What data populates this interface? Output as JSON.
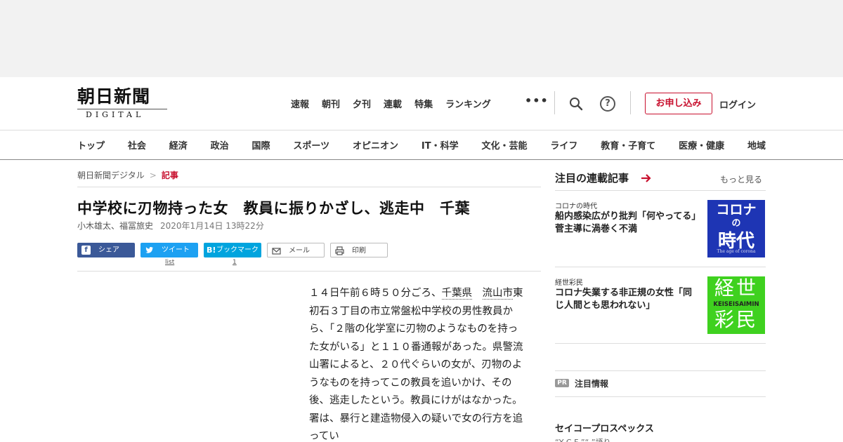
{
  "header": {
    "logo_main": "朝日新聞",
    "logo_sub": "DIGITAL",
    "nav": [
      "速報",
      "朝刊",
      "夕刊",
      "連載",
      "特集",
      "ランキング"
    ],
    "more": "•••",
    "help": "?",
    "subscribe_label": "お申し込み",
    "login_label": "ログイン"
  },
  "categories": [
    "トップ",
    "社会",
    "経済",
    "政治",
    "国際",
    "スポーツ",
    "オピニオン",
    "IT・科学",
    "文化・芸能",
    "ライフ",
    "教育・子育て",
    "医療・健康",
    "地域"
  ],
  "breadcrumb": {
    "home": "朝日新聞デジタル",
    "separator": ">",
    "current": "記事"
  },
  "article": {
    "headline": "中学校に刃物持った女　教員に振りかざし、逃走中　千葉",
    "authors": "小木雄太、福冨旅史",
    "date": "2020年1月14日 13時22分",
    "body": {
      "p1_start": "１４日午前６時５０分ごろ、",
      "link1": "千葉県",
      "link2": "流山市",
      "p1_rest": "東初石３丁目の市立常盤松中学校の男性教員から、「２階の化学室に刃物のようなものを持った女がいる」と１１０番通報があった。県警流山署によると、２０代ぐらいの女が、刃物のようなものを持ってこの教員を追いかけ、その後、逃走したという。教員にけがはなかった。署は、暴行と建造物侵入の疑いで女の行方を追ってい"
    }
  },
  "share": {
    "facebook": {
      "icon": "f",
      "label": "シェア"
    },
    "twitter": {
      "icon": "t",
      "label": "ツイート",
      "count": "list"
    },
    "hatena": {
      "icon": "B!",
      "label": "ブックマーク",
      "count": "1"
    },
    "mail": {
      "label": "メール"
    },
    "print": {
      "label": "印刷"
    }
  },
  "sidebar": {
    "heading": "注目の連載記事",
    "more": "もっと見る",
    "items": [
      {
        "category": "コロナの時代",
        "title": "船内感染広がり批判「何やってる」　菅主導に渦巻く不満",
        "thumb": {
          "line1": "コロナ",
          "line2": "の",
          "line3": "時代",
          "line4": "The age of corona"
        }
      },
      {
        "category": "経世彩民",
        "title": "コロナ失業する非正規の女性「同じ人間とも思われない」",
        "thumb": {
          "line1": "経世",
          "line2": "KEISEISAIMIN",
          "line3": "彩民"
        }
      }
    ],
    "pr_badge": "PR",
    "pr_label": "注目情報",
    "advertiser": "セイコープロスペックス",
    "ad_subtitle": "“Y    C    F        ”“   ”語り"
  },
  "colors": {
    "brand_red": "#c8102e",
    "facebook": "#3b5998",
    "twitter": "#1da1f2",
    "hatena": "#00a4de",
    "corona_thumb": "#1e35b4",
    "keisei_thumb": "#3fd11f"
  }
}
